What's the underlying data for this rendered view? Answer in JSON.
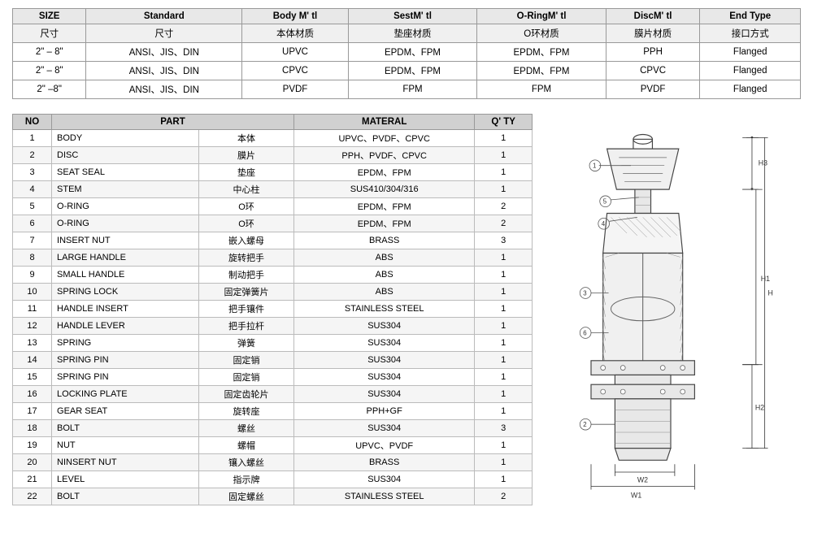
{
  "spec_table": {
    "headers": [
      "SIZE",
      "Standard",
      "Body M' tl",
      "SestM' tl",
      "O-RingM' tl",
      "DiscM' tl",
      "End Type"
    ],
    "headers_cn": [
      "尺寸",
      "尺寸",
      "本体材质",
      "垫座材质",
      "O环材质",
      "膜片材质",
      "接口方式"
    ],
    "rows": [
      [
        "2\" – 8\"",
        "ANSI、JIS、DIN",
        "UPVC",
        "EPDM、FPM",
        "EPDM、FPM",
        "PPH",
        "Flanged"
      ],
      [
        "2\" – 8\"",
        "ANSI、JIS、DIN",
        "CPVC",
        "EPDM、FPM",
        "EPDM、FPM",
        "CPVC",
        "Flanged"
      ],
      [
        "2\" –8\"",
        "ANSI、JIS、DIN",
        "PVDF",
        "FPM",
        "FPM",
        "PVDF",
        "Flanged"
      ]
    ]
  },
  "parts_table": {
    "headers": [
      "NO",
      "PART",
      "",
      "MATERAL",
      "Q' TY"
    ],
    "rows": [
      [
        "1",
        "BODY",
        "本体",
        "UPVC、PVDF、CPVC",
        "1"
      ],
      [
        "2",
        "DISC",
        "膜片",
        "PPH、PVDF、CPVC",
        "1"
      ],
      [
        "3",
        "SEAT SEAL",
        "垫座",
        "EPDM、FPM",
        "1"
      ],
      [
        "4",
        "STEM",
        "中心柱",
        "SUS410/304/316",
        "1"
      ],
      [
        "5",
        "O-RING",
        "O环",
        "EPDM、FPM",
        "2"
      ],
      [
        "6",
        "O-RING",
        "O环",
        "EPDM、FPM",
        "2"
      ],
      [
        "7",
        "INSERT NUT",
        "嵌入螺母",
        "BRASS",
        "3"
      ],
      [
        "8",
        "LARGE HANDLE",
        "旋转把手",
        "ABS",
        "1"
      ],
      [
        "9",
        "SMALL HANDLE",
        "制动把手",
        "ABS",
        "1"
      ],
      [
        "10",
        "SPRING LOCK",
        "固定弹簧片",
        "ABS",
        "1"
      ],
      [
        "11",
        "HANDLE INSERT",
        "把手镶件",
        "STAINLESS STEEL",
        "1"
      ],
      [
        "12",
        "HANDLE LEVER",
        "把手拉杆",
        "SUS304",
        "1"
      ],
      [
        "13",
        "SPRING",
        "弹簧",
        "SUS304",
        "1"
      ],
      [
        "14",
        "SPRING PIN",
        "固定销",
        "SUS304",
        "1"
      ],
      [
        "15",
        "SPRING PIN",
        "固定销",
        "SUS304",
        "1"
      ],
      [
        "16",
        "LOCKING PLATE",
        "固定齿轮片",
        "SUS304",
        "1"
      ],
      [
        "17",
        "GEAR SEAT",
        "旋转座",
        "PPH+GF",
        "1"
      ],
      [
        "18",
        "BOLT",
        "螺丝",
        "SUS304",
        "3"
      ],
      [
        "19",
        "NUT",
        "螺帽",
        "UPVC、PVDF",
        "1"
      ],
      [
        "20",
        "NINSERT NUT",
        "镶入螺丝",
        "BRASS",
        "1"
      ],
      [
        "21",
        "LEVEL",
        "指示牌",
        "SUS304",
        "1"
      ],
      [
        "22",
        "BOLT",
        "固定螺丝",
        "STAINLESS STEEL",
        "2"
      ]
    ]
  },
  "colors": {
    "table_header_bg": "#d0d0d0",
    "table_border": "#999999",
    "accent": "#555555"
  }
}
